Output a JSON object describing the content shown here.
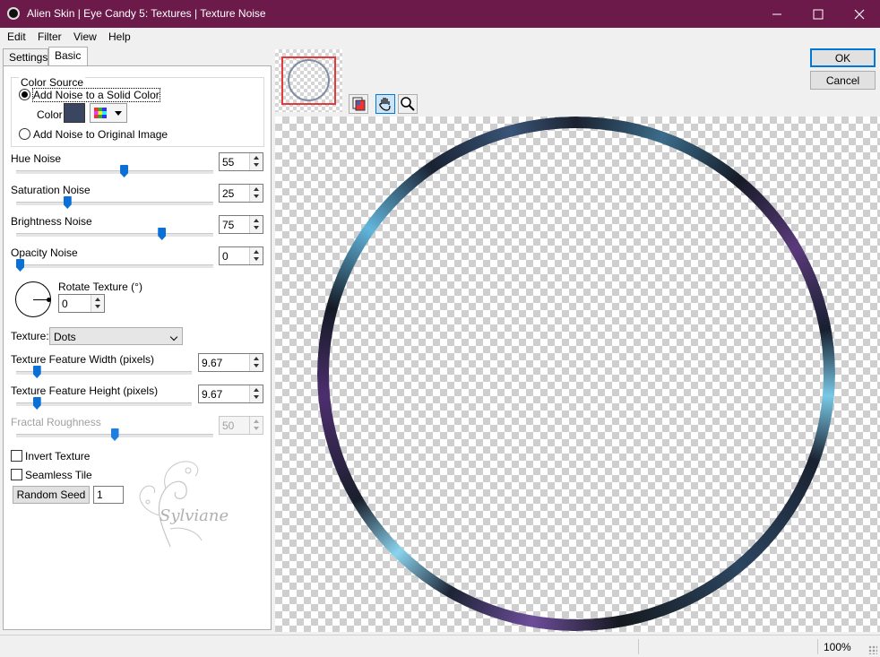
{
  "window": {
    "title": "Alien Skin | Eye Candy 5: Textures | Texture Noise"
  },
  "menu": {
    "items": [
      "Edit",
      "Filter",
      "View",
      "Help"
    ]
  },
  "tabs": [
    "Settings",
    "Basic"
  ],
  "active_tab": "Basic",
  "color_source": {
    "title": "Color Source",
    "option_solid": "Add Noise to a Solid Color",
    "color_label": "Color",
    "color_value": "#3a4660",
    "option_original": "Add Noise to Original Image",
    "selected": "solid"
  },
  "sliders": {
    "hue_noise": {
      "label": "Hue Noise",
      "value": "55",
      "fraction": 0.55
    },
    "saturation_noise": {
      "label": "Saturation Noise",
      "value": "25",
      "fraction": 0.25
    },
    "brightness_noise": {
      "label": "Brightness Noise",
      "value": "75",
      "fraction": 0.75
    },
    "opacity_noise": {
      "label": "Opacity Noise",
      "value": "0",
      "fraction": 0.0
    },
    "feature_width": {
      "label": "Texture Feature Width (pixels)",
      "value": "9.67",
      "fraction": 0.1
    },
    "feature_height": {
      "label": "Texture Feature Height (pixels)",
      "value": "9.67",
      "fraction": 0.1
    },
    "fractal_roughness": {
      "label": "Fractal Roughness",
      "value": "50",
      "fraction": 0.5,
      "disabled": true
    }
  },
  "rotate": {
    "label": "Rotate Texture (°)",
    "value": "0"
  },
  "texture": {
    "label": "Texture:",
    "value": "Dots"
  },
  "checks": {
    "invert": "Invert Texture",
    "seamless": "Seamless Tile"
  },
  "random_seed": {
    "button": "Random Seed",
    "value": "1"
  },
  "watermark_text": "Sylviane",
  "buttons": {
    "ok": "OK",
    "cancel": "Cancel"
  },
  "status": {
    "zoom": "100%"
  }
}
